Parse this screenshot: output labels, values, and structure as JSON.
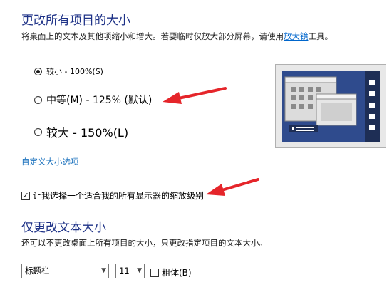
{
  "size_section": {
    "heading": "更改所有项目的大小",
    "description_before_link": "将桌面上的文本及其他项缩小和增大。若要临时仅放大部分屏幕，请使用",
    "magnifier_link": "放大镜",
    "description_after_link": "工具。",
    "options": [
      {
        "label": "较小 - 100%(S)",
        "checked": true
      },
      {
        "label": "中等(M) - 125% (默认)",
        "checked": false
      },
      {
        "label": "较大 - 150%(L)",
        "checked": false
      }
    ],
    "custom_link": "自定义大小选项",
    "scaling_checkbox_label": "让我选择一个适合我的所有显示器的缩放级别",
    "scaling_checkbox_checked": true
  },
  "text_section": {
    "heading": "仅更改文本大小",
    "description": "还可以不更改桌面上所有项目的大小，只更改指定项目的文本大小。",
    "item_select_value": "标题栏",
    "size_select_value": "11",
    "bold_label": "粗体(B)",
    "bold_checked": false
  },
  "annotation_color": "#e5252a",
  "preview_colors": {
    "background": "#2e4a8c",
    "frame": "#c8c8c8"
  }
}
